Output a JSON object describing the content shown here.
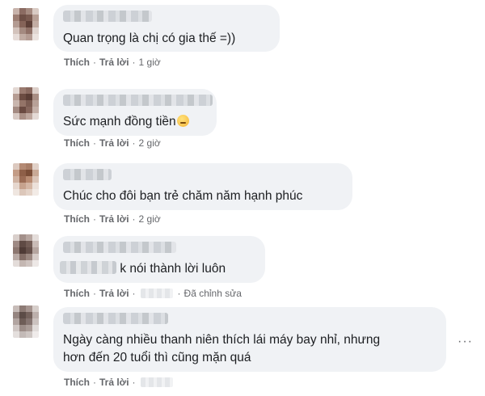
{
  "comments": [
    {
      "text_line1": "Quan trọng là chị có gia thế =))",
      "like_label": "Thích",
      "reply_label": "Trả lời",
      "time": "1 giờ"
    },
    {
      "text_line1": "Sức mạnh đồng tiền",
      "emoji_icon": "sad-face-emoji",
      "like_label": "Thích",
      "reply_label": "Trả lời",
      "time": "2 giờ"
    },
    {
      "text_line1": "Chúc cho đôi bạn trẻ chăm năm hạnh phúc",
      "like_label": "Thích",
      "reply_label": "Trả lời",
      "time": "2 giờ"
    },
    {
      "text_line1": "k nói thành lời luôn",
      "like_label": "Thích",
      "reply_label": "Trả lời",
      "edited_label": "Đã chỉnh sửa"
    },
    {
      "text_line1": "Ngày càng nhiều thanh niên thích lái máy bay nhỉ, nhưng",
      "text_line2": "hơn đến 20 tuổi thì cũng mặn quá",
      "like_label": "Thích",
      "reply_label": "Trả lời",
      "more_icon": "more-options-icon"
    }
  ],
  "separator": "·"
}
